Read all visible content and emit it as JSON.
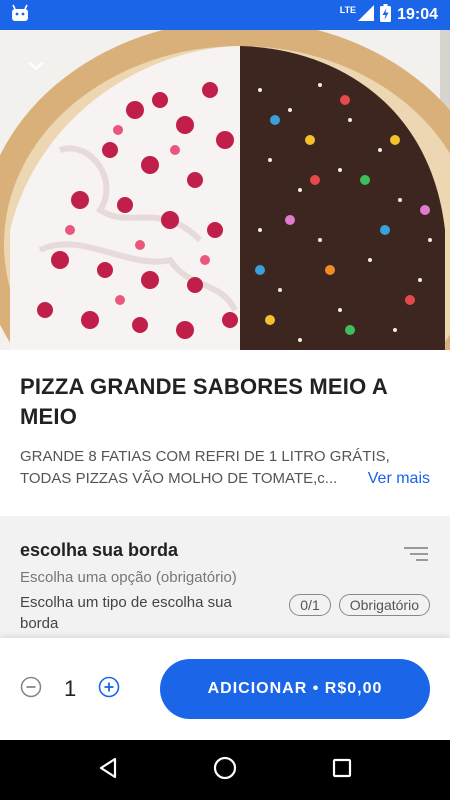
{
  "status_bar": {
    "time": "19:04",
    "network": "LTE",
    "icons": [
      "android-icon",
      "signal-icon",
      "battery-icon"
    ],
    "color": "#1a65e8"
  },
  "header": {
    "back_icon": "chevron-down-icon"
  },
  "product": {
    "title": " PIZZA GRANDE SABORES MEIO A MEIO",
    "description_line1": "GRANDE 8 FATIAS  COM REFRI DE 1 LITRO GRÁTIS,",
    "description_line2": "TODAS PIZZAS VÃO MOLHO DE TOMATE,c...",
    "see_more": "Ver mais"
  },
  "options": {
    "title": "escolha sua borda",
    "subtitle": "Escolha uma opção (obrigatório)",
    "hint": "Escolha um tipo de escolha sua borda",
    "count_badge": "0/1",
    "required_badge": "Obrigatório",
    "filter_icon": "filter-lines-icon"
  },
  "cart": {
    "quantity": "1",
    "add_label": "ADICIONAR • R$0,00",
    "accent": "#1a65e8"
  },
  "nav": {
    "icons": [
      "back-triangle-icon",
      "home-circle-icon",
      "recents-square-icon"
    ]
  }
}
